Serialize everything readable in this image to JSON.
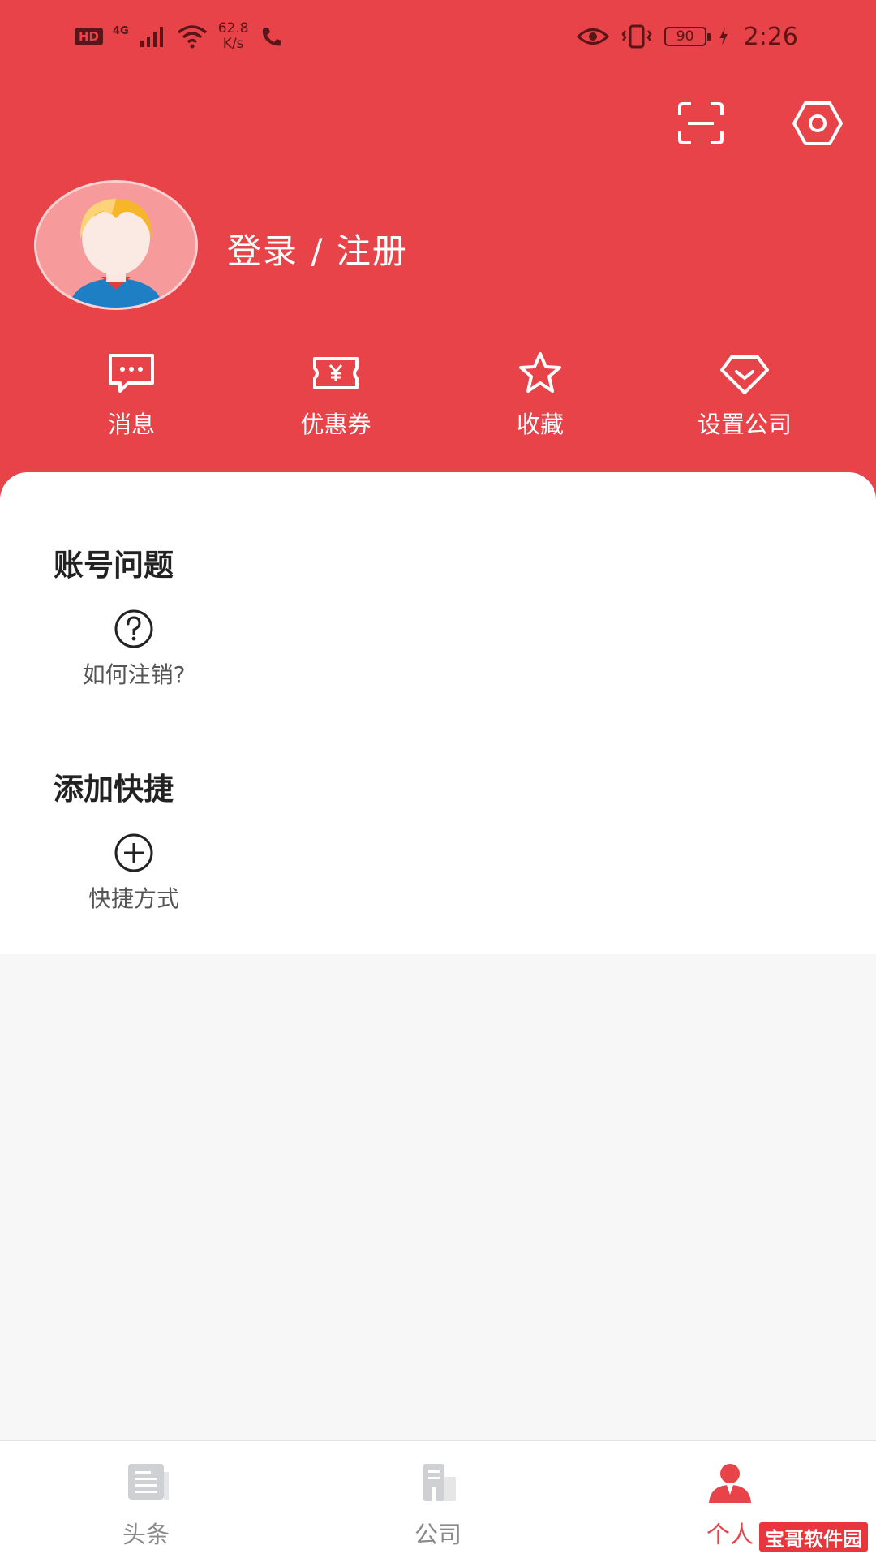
{
  "status_bar": {
    "hd_badge": "HD",
    "network_type": "4G",
    "speed_value": "62.8",
    "speed_unit": "K/s",
    "battery": "90",
    "time": "2:26"
  },
  "header": {
    "background": "#e84348",
    "scan_icon": "scan-icon",
    "settings_icon": "settings-icon",
    "login_label": "登录 / 注册",
    "avatar_icon": "user-avatar-icon"
  },
  "quick_actions": [
    {
      "label": "消息",
      "icon": "message-icon"
    },
    {
      "label": "优惠券",
      "icon": "coupon-icon"
    },
    {
      "label": "收藏",
      "icon": "star-icon"
    },
    {
      "label": "设置公司",
      "icon": "diamond-icon"
    }
  ],
  "sections": {
    "account": {
      "title": "账号问题",
      "items": [
        {
          "label": "如何注销?",
          "icon": "question-icon"
        }
      ]
    },
    "shortcuts": {
      "title": "添加快捷",
      "items": [
        {
          "label": "快捷方式",
          "icon": "add-icon"
        }
      ]
    }
  },
  "bottom_nav": {
    "items": [
      {
        "label": "头条",
        "icon": "news-icon",
        "active": false
      },
      {
        "label": "公司",
        "icon": "company-icon",
        "active": false
      },
      {
        "label": "个人",
        "icon": "person-icon",
        "active": true
      }
    ],
    "active_color": "#e84348",
    "inactive_color": "#8a8a8a"
  },
  "watermark": "宝哥软件园"
}
